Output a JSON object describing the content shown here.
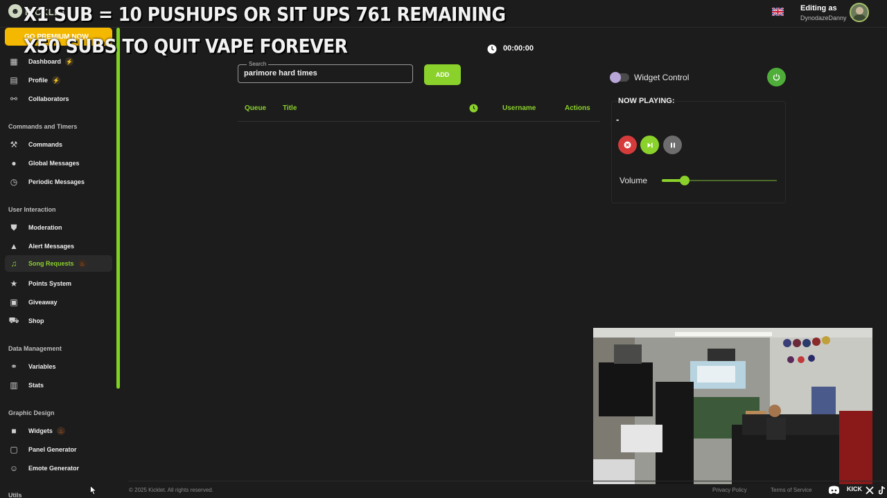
{
  "header": {
    "logo_text": "KICKLET",
    "editing_label": "Editing as",
    "editing_user": "DynodazeDanny"
  },
  "overlay": {
    "line1": "X1 SUB = 10 PUSHUPS OR SIT UPS 761 REMAINING",
    "line2": "X50 SUBS TO QUIT VAPE FOREVER"
  },
  "sidebar": {
    "premium_label": "GO PREMIUM NOW",
    "items": [
      {
        "label": "Dashboard",
        "icon": "dashboard-icon"
      },
      {
        "label": "Profile",
        "icon": "profile-icon"
      },
      {
        "label": "Collaborators",
        "icon": "collaborators-icon"
      }
    ],
    "sections": [
      {
        "title": "Commands and Timers",
        "items": [
          {
            "label": "Commands",
            "icon": "hammer-icon"
          },
          {
            "label": "Global Messages",
            "icon": "chat-icon"
          },
          {
            "label": "Periodic Messages",
            "icon": "clock-icon"
          }
        ]
      },
      {
        "title": "User Interaction",
        "items": [
          {
            "label": "Moderation",
            "icon": "shield-icon"
          },
          {
            "label": "Alert Messages",
            "icon": "warning-icon"
          },
          {
            "label": "Song Requests",
            "icon": "music-icon"
          },
          {
            "label": "Points System",
            "icon": "star-icon"
          },
          {
            "label": "Giveaway",
            "icon": "gift-icon"
          },
          {
            "label": "Shop",
            "icon": "cart-icon"
          }
        ]
      },
      {
        "title": "Data Management",
        "items": [
          {
            "label": "Variables",
            "icon": "link-icon"
          },
          {
            "label": "Stats",
            "icon": "stats-icon"
          }
        ]
      },
      {
        "title": "Graphic Design",
        "items": [
          {
            "label": "Widgets",
            "icon": "camera-icon"
          },
          {
            "label": "Panel Generator",
            "icon": "panel-icon"
          },
          {
            "label": "Emote Generator",
            "icon": "emote-icon"
          }
        ]
      },
      {
        "title": "Utils",
        "items": []
      }
    ]
  },
  "search": {
    "label": "Search",
    "value": "parimore hard times"
  },
  "add_label": "ADD",
  "timer": "00:00:00",
  "table": {
    "headers": [
      "Queue",
      "Title",
      "Username",
      "Actions"
    ]
  },
  "widget_control": {
    "label": "Widget Control",
    "enabled": false
  },
  "now_playing": {
    "title": "NOW PLAYING:",
    "song": "-",
    "volume_label": "Volume",
    "volume": 0.2
  },
  "footer": {
    "copyright": "© 2025 Kicklet. All rights reserved.",
    "privacy": "Privacy Policy",
    "terms": "Terms of Service",
    "kick": "KICK"
  },
  "colors": {
    "accent": "#8bd12c",
    "premium": "#f5b800",
    "stop": "#d63b3b",
    "background": "#1c1c1c"
  }
}
